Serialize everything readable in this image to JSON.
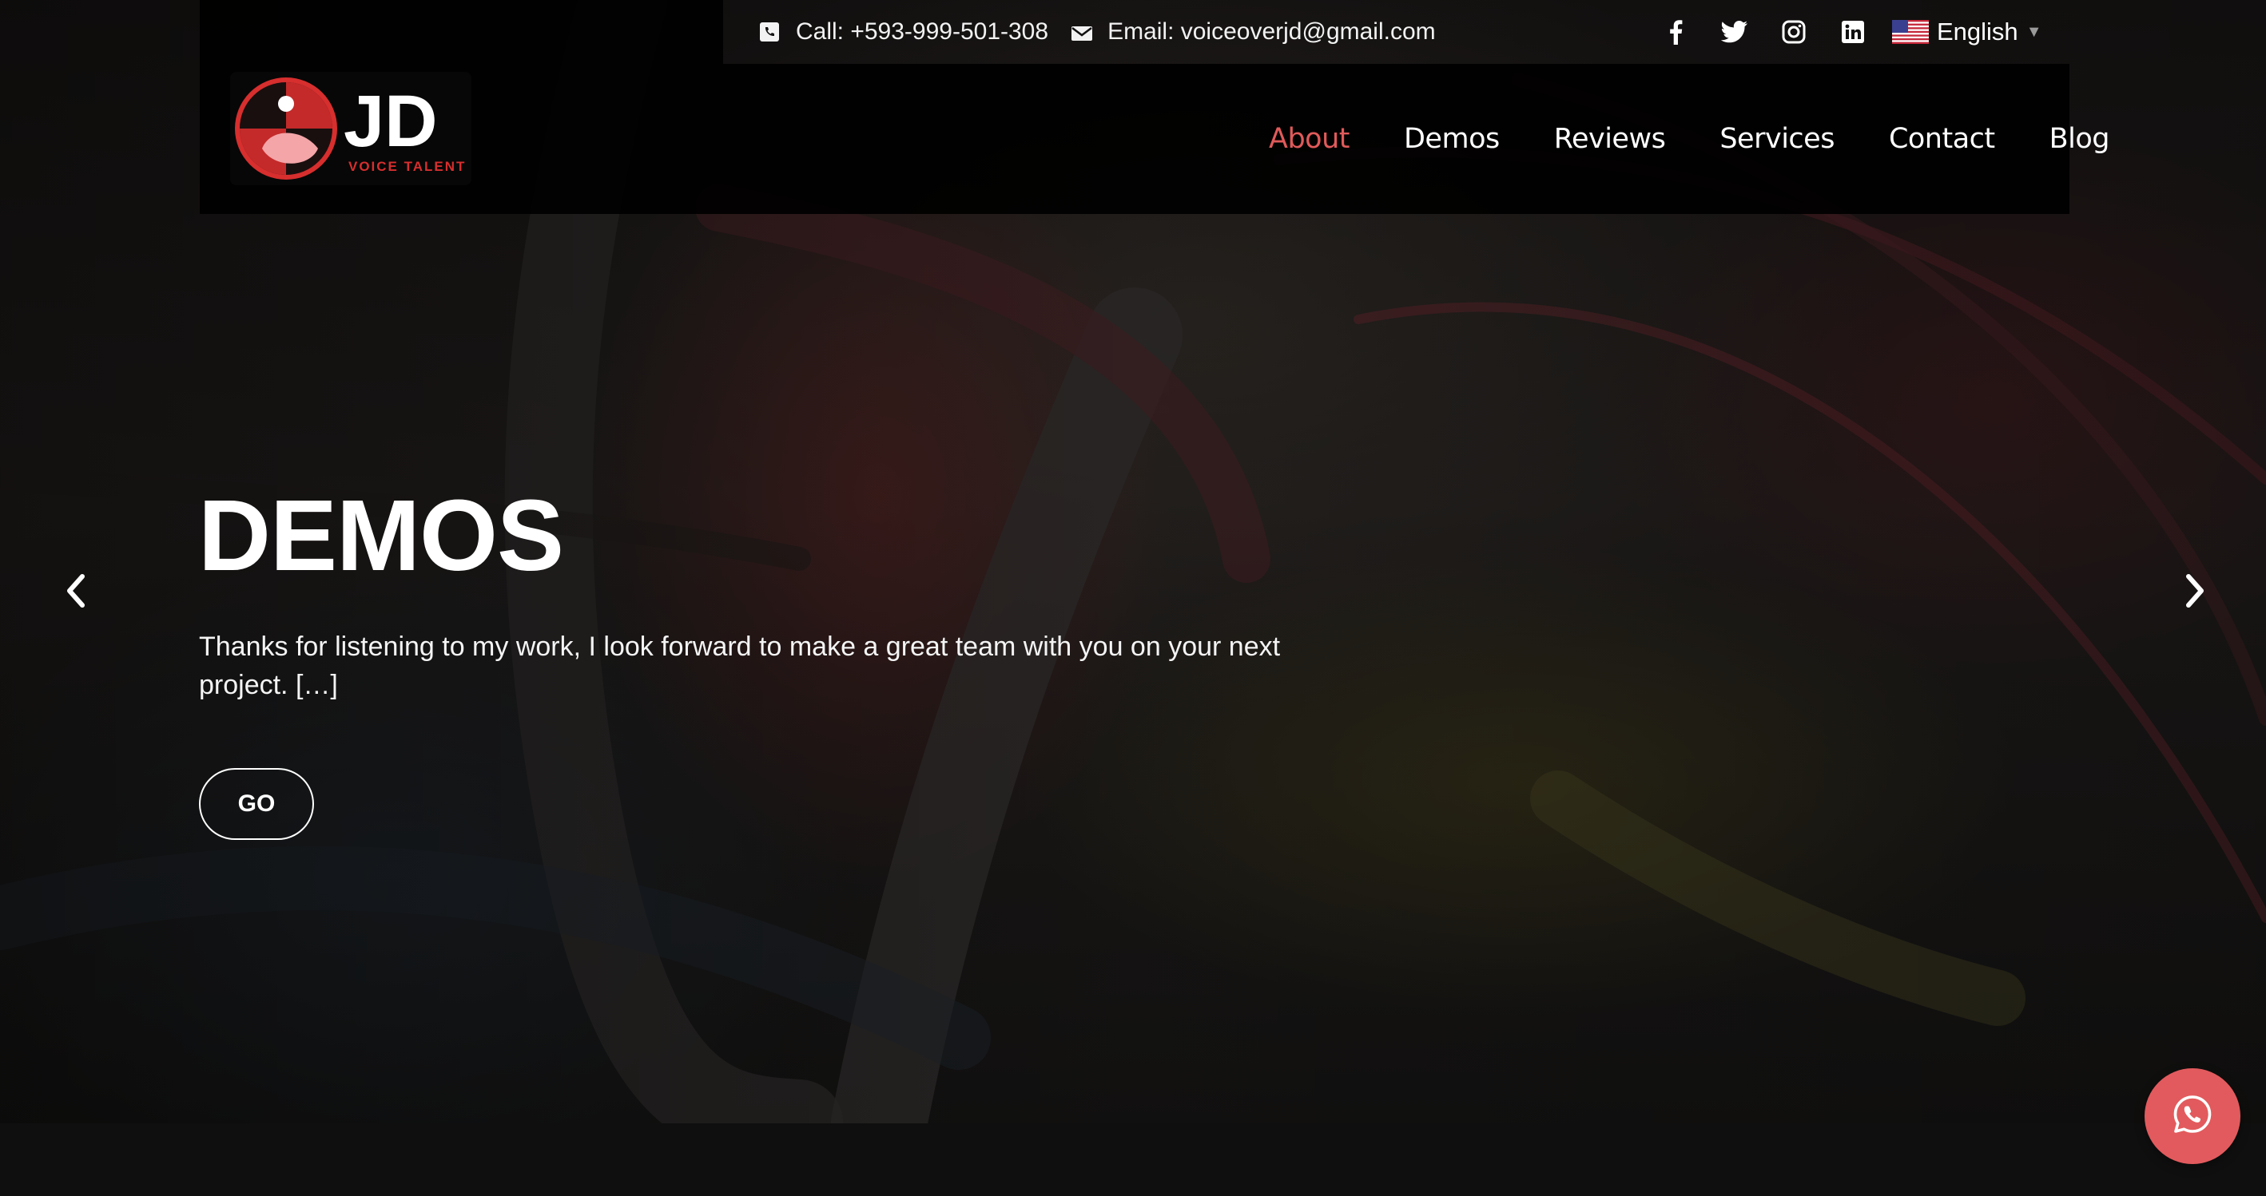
{
  "topbar": {
    "phone": "Call: +593-999-501-308",
    "email": "Email: voiceoverjd@gmail.com",
    "social_icons": [
      "facebook-icon",
      "twitter-icon",
      "instagram-icon",
      "linkedin-icon"
    ],
    "language": "English"
  },
  "logo": {
    "mark": "JD",
    "tagline": "VOICE TALENT"
  },
  "nav": {
    "items": [
      {
        "label": "About",
        "active": true
      },
      {
        "label": "Demos",
        "active": false
      },
      {
        "label": "Reviews",
        "active": false
      },
      {
        "label": "Services",
        "active": false
      },
      {
        "label": "Contact",
        "active": false
      },
      {
        "label": "Blog",
        "active": false
      }
    ]
  },
  "hero": {
    "title": "DEMOS",
    "text": "Thanks for listening to my work, I look forward to make a great team with you on your next project. […]",
    "button": "GO"
  },
  "colors": {
    "accent": "#e05a5a",
    "whatsapp_bg": "#e25a5d",
    "header_bg": "#000000"
  }
}
